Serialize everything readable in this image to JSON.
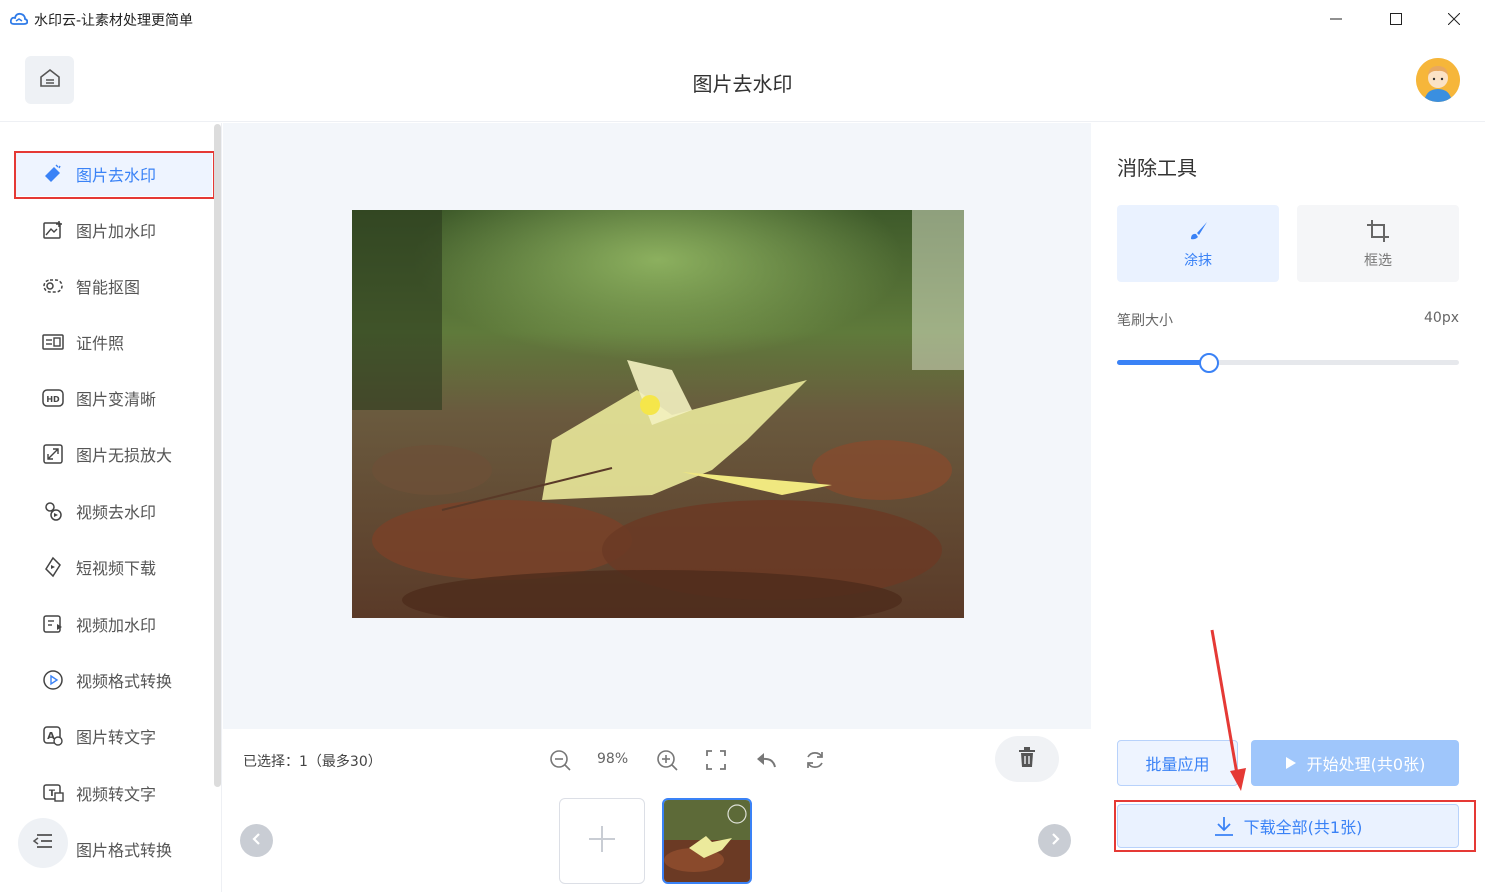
{
  "window": {
    "title": "水印云-让素材处理更简单"
  },
  "header": {
    "title": "图片去水印"
  },
  "sidebar": {
    "items": [
      {
        "label": "图片去水印",
        "icon": "eraser-icon",
        "active": true
      },
      {
        "label": "图片加水印",
        "icon": "image-add-icon"
      },
      {
        "label": "智能抠图",
        "icon": "cutout-icon"
      },
      {
        "label": "证件照",
        "icon": "id-card-icon"
      },
      {
        "label": "图片变清晰",
        "icon": "hd-icon"
      },
      {
        "label": "图片无损放大",
        "icon": "enlarge-icon"
      },
      {
        "label": "视频去水印",
        "icon": "video-eraser-icon"
      },
      {
        "label": "短视频下载",
        "icon": "short-video-download-icon"
      },
      {
        "label": "视频加水印",
        "icon": "video-watermark-icon"
      },
      {
        "label": "视频格式转换",
        "icon": "video-convert-icon"
      },
      {
        "label": "图片转文字",
        "icon": "image-to-text-icon"
      },
      {
        "label": "视频转文字",
        "icon": "video-to-text-icon"
      },
      {
        "label": "图片格式转换",
        "icon": "image-convert-icon"
      }
    ]
  },
  "editor": {
    "selected_text": "已选择：1（最多30）",
    "zoom": "98%"
  },
  "tools": {
    "title": "消除工具",
    "smear_label": "涂抹",
    "box_label": "框选",
    "brush_label": "笔刷大小",
    "brush_value": "40px",
    "brush_fraction": 0.27
  },
  "actions": {
    "batch_label": "批量应用",
    "start_label": "开始处理(共0张)",
    "download_label": "下载全部(共1张)"
  },
  "colors": {
    "accent": "#3a82f6",
    "annotation": "#e53935"
  }
}
